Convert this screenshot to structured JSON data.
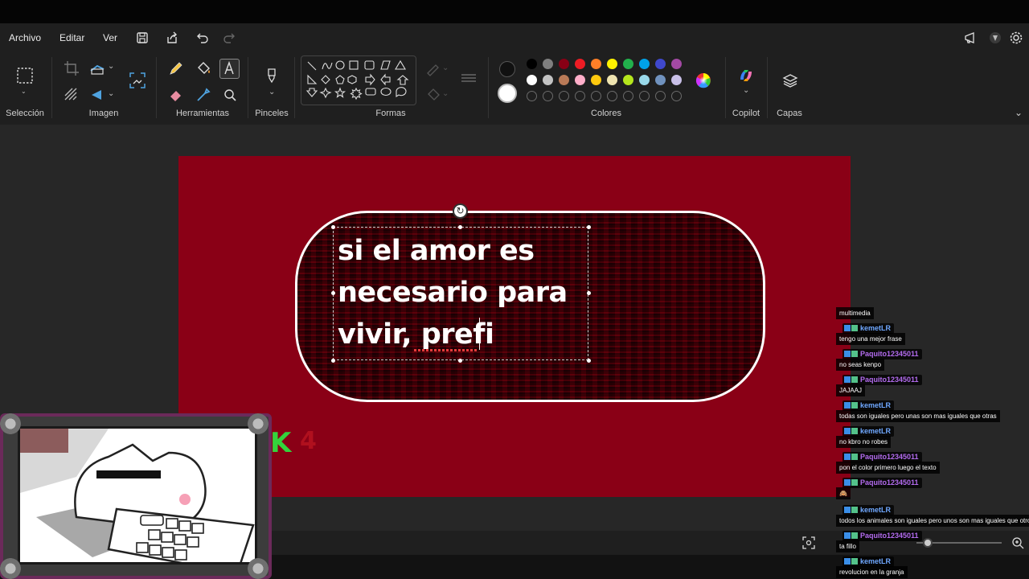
{
  "menu": {
    "file": "Archivo",
    "edit": "Editar",
    "view": "Ver"
  },
  "ribbon": {
    "groups": [
      "Selección",
      "Imagen",
      "Herramientas",
      "Pinceles",
      "Formas",
      "Colores",
      "Copilot",
      "Capas"
    ],
    "active_tool": "text",
    "primary_color": "#111111",
    "secondary_color": "#ffffff",
    "palette_row1": [
      "#000000",
      "#7f7f7f",
      "#880015",
      "#ed1c24",
      "#ff7f27",
      "#fff200",
      "#22b14c",
      "#00a2e8",
      "#3f48cc",
      "#a349a4"
    ],
    "palette_row2": [
      "#ffffff",
      "#c3c3c3",
      "#b97a57",
      "#ffaec9",
      "#ffc90e",
      "#efe4b0",
      "#b5e61d",
      "#99d9ea",
      "#7092be",
      "#c8bfe7"
    ],
    "palette_row3_empty": 10
  },
  "canvas": {
    "background": "#8a0016",
    "text_lines": [
      "si el amor es",
      "necesario para",
      "vivir, prefi"
    ]
  },
  "overlay": {
    "k_letter": "K",
    "k_number": "4"
  },
  "chat": [
    {
      "user": "",
      "message": "multimedia"
    },
    {
      "user": "kemetLR",
      "message": "tengo una mejor frase",
      "color": "#6fa8ff"
    },
    {
      "user": "Paquito12345011",
      "message": "no seas kenpo",
      "color": "#b46cf0"
    },
    {
      "user": "Paquito12345011",
      "message": "JAJAAJ",
      "color": "#b46cf0"
    },
    {
      "user": "kemetLR",
      "message": "todas son iguales pero unas son mas iguales que otras",
      "color": "#6fa8ff"
    },
    {
      "user": "kemetLR",
      "message": "no kbro no robes",
      "color": "#6fa8ff"
    },
    {
      "user": "Paquito12345011",
      "message": "pon el color primero luego el texto",
      "color": "#b46cf0"
    },
    {
      "user": "Paquito12345011",
      "message": "🙈",
      "color": "#b46cf0"
    },
    {
      "user": "kemetLR",
      "message": "todos los animales son iguales pero unos son mas iguales que otros",
      "color": "#6fa8ff"
    },
    {
      "user": "Paquito12345011",
      "message": "ta fillo",
      "color": "#b46cf0"
    },
    {
      "user": "kemetLR",
      "message": "revolucion en la granja",
      "color": "#6fa8ff"
    }
  ]
}
